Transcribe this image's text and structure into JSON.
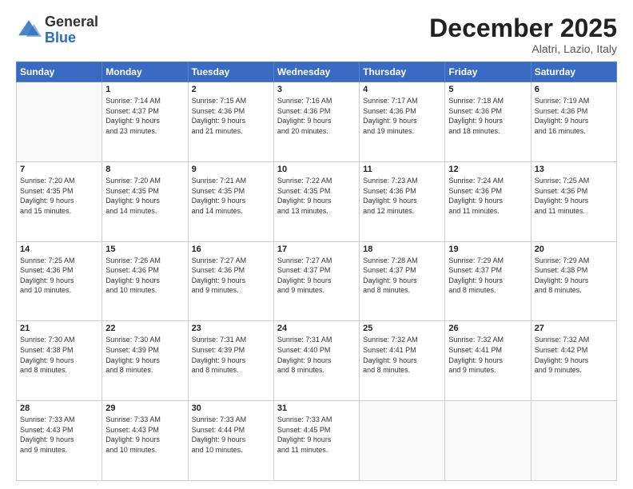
{
  "logo": {
    "general": "General",
    "blue": "Blue"
  },
  "header": {
    "title": "December 2025",
    "subtitle": "Alatri, Lazio, Italy"
  },
  "days_of_week": [
    "Sunday",
    "Monday",
    "Tuesday",
    "Wednesday",
    "Thursday",
    "Friday",
    "Saturday"
  ],
  "weeks": [
    [
      {
        "day": "",
        "info": ""
      },
      {
        "day": "1",
        "info": "Sunrise: 7:14 AM\nSunset: 4:37 PM\nDaylight: 9 hours\nand 23 minutes."
      },
      {
        "day": "2",
        "info": "Sunrise: 7:15 AM\nSunset: 4:36 PM\nDaylight: 9 hours\nand 21 minutes."
      },
      {
        "day": "3",
        "info": "Sunrise: 7:16 AM\nSunset: 4:36 PM\nDaylight: 9 hours\nand 20 minutes."
      },
      {
        "day": "4",
        "info": "Sunrise: 7:17 AM\nSunset: 4:36 PM\nDaylight: 9 hours\nand 19 minutes."
      },
      {
        "day": "5",
        "info": "Sunrise: 7:18 AM\nSunset: 4:36 PM\nDaylight: 9 hours\nand 18 minutes."
      },
      {
        "day": "6",
        "info": "Sunrise: 7:19 AM\nSunset: 4:36 PM\nDaylight: 9 hours\nand 16 minutes."
      }
    ],
    [
      {
        "day": "7",
        "info": "Sunrise: 7:20 AM\nSunset: 4:35 PM\nDaylight: 9 hours\nand 15 minutes."
      },
      {
        "day": "8",
        "info": "Sunrise: 7:20 AM\nSunset: 4:35 PM\nDaylight: 9 hours\nand 14 minutes."
      },
      {
        "day": "9",
        "info": "Sunrise: 7:21 AM\nSunset: 4:35 PM\nDaylight: 9 hours\nand 14 minutes."
      },
      {
        "day": "10",
        "info": "Sunrise: 7:22 AM\nSunset: 4:35 PM\nDaylight: 9 hours\nand 13 minutes."
      },
      {
        "day": "11",
        "info": "Sunrise: 7:23 AM\nSunset: 4:36 PM\nDaylight: 9 hours\nand 12 minutes."
      },
      {
        "day": "12",
        "info": "Sunrise: 7:24 AM\nSunset: 4:36 PM\nDaylight: 9 hours\nand 11 minutes."
      },
      {
        "day": "13",
        "info": "Sunrise: 7:25 AM\nSunset: 4:36 PM\nDaylight: 9 hours\nand 11 minutes."
      }
    ],
    [
      {
        "day": "14",
        "info": "Sunrise: 7:25 AM\nSunset: 4:36 PM\nDaylight: 9 hours\nand 10 minutes."
      },
      {
        "day": "15",
        "info": "Sunrise: 7:26 AM\nSunset: 4:36 PM\nDaylight: 9 hours\nand 10 minutes."
      },
      {
        "day": "16",
        "info": "Sunrise: 7:27 AM\nSunset: 4:36 PM\nDaylight: 9 hours\nand 9 minutes."
      },
      {
        "day": "17",
        "info": "Sunrise: 7:27 AM\nSunset: 4:37 PM\nDaylight: 9 hours\nand 9 minutes."
      },
      {
        "day": "18",
        "info": "Sunrise: 7:28 AM\nSunset: 4:37 PM\nDaylight: 9 hours\nand 8 minutes."
      },
      {
        "day": "19",
        "info": "Sunrise: 7:29 AM\nSunset: 4:37 PM\nDaylight: 9 hours\nand 8 minutes."
      },
      {
        "day": "20",
        "info": "Sunrise: 7:29 AM\nSunset: 4:38 PM\nDaylight: 9 hours\nand 8 minutes."
      }
    ],
    [
      {
        "day": "21",
        "info": "Sunrise: 7:30 AM\nSunset: 4:38 PM\nDaylight: 9 hours\nand 8 minutes."
      },
      {
        "day": "22",
        "info": "Sunrise: 7:30 AM\nSunset: 4:39 PM\nDaylight: 9 hours\nand 8 minutes."
      },
      {
        "day": "23",
        "info": "Sunrise: 7:31 AM\nSunset: 4:39 PM\nDaylight: 9 hours\nand 8 minutes."
      },
      {
        "day": "24",
        "info": "Sunrise: 7:31 AM\nSunset: 4:40 PM\nDaylight: 9 hours\nand 8 minutes."
      },
      {
        "day": "25",
        "info": "Sunrise: 7:32 AM\nSunset: 4:41 PM\nDaylight: 9 hours\nand 8 minutes."
      },
      {
        "day": "26",
        "info": "Sunrise: 7:32 AM\nSunset: 4:41 PM\nDaylight: 9 hours\nand 9 minutes."
      },
      {
        "day": "27",
        "info": "Sunrise: 7:32 AM\nSunset: 4:42 PM\nDaylight: 9 hours\nand 9 minutes."
      }
    ],
    [
      {
        "day": "28",
        "info": "Sunrise: 7:33 AM\nSunset: 4:43 PM\nDaylight: 9 hours\nand 9 minutes."
      },
      {
        "day": "29",
        "info": "Sunrise: 7:33 AM\nSunset: 4:43 PM\nDaylight: 9 hours\nand 10 minutes."
      },
      {
        "day": "30",
        "info": "Sunrise: 7:33 AM\nSunset: 4:44 PM\nDaylight: 9 hours\nand 10 minutes."
      },
      {
        "day": "31",
        "info": "Sunrise: 7:33 AM\nSunset: 4:45 PM\nDaylight: 9 hours\nand 11 minutes."
      },
      {
        "day": "",
        "info": ""
      },
      {
        "day": "",
        "info": ""
      },
      {
        "day": "",
        "info": ""
      }
    ]
  ]
}
